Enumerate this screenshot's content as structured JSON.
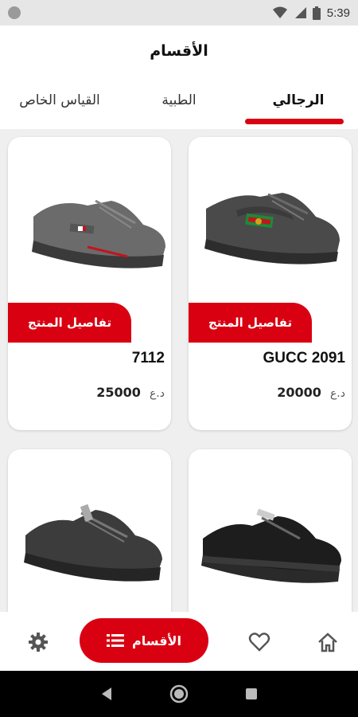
{
  "status_bar": {
    "time": "5:39"
  },
  "app_bar": {
    "title": "الأقسام"
  },
  "tabs": [
    {
      "label": "الرجالي",
      "active": true
    },
    {
      "label": "الطبية",
      "active": false
    },
    {
      "label": "القياس الخاص",
      "active": false
    }
  ],
  "products": [
    {
      "name": "GUCC 2091",
      "price": "20000",
      "currency": "د.ع",
      "details_label": "تفاصيل المنتج"
    },
    {
      "name": "7112",
      "price": "25000",
      "currency": "د.ع",
      "details_label": "تفاصيل المنتج"
    },
    {
      "name": "",
      "price": "",
      "currency": "",
      "details_label": ""
    },
    {
      "name": "",
      "price": "",
      "currency": "",
      "details_label": ""
    }
  ],
  "bottom_nav": {
    "active_label": "الأقسام",
    "items": [
      "home-icon",
      "heart-icon",
      "list-icon",
      "gear-icon"
    ]
  },
  "colors": {
    "accent": "#d90012",
    "background": "#efefef"
  }
}
